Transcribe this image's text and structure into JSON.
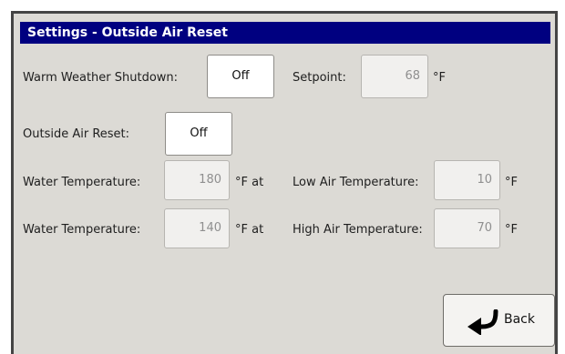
{
  "window": {
    "title": "Settings - Outside Air Reset"
  },
  "warm_weather": {
    "label": "Warm Weather Shutdown:",
    "toggle": "Off",
    "setpoint_label": "Setpoint:",
    "setpoint_value": "68",
    "unit": "°F"
  },
  "oar": {
    "label": "Outside Air Reset:",
    "toggle": "Off"
  },
  "rows": [
    {
      "water_label": "Water Temperature:",
      "water_value": "180",
      "unit_at": "°F  at",
      "air_label": "Low Air Temperature:",
      "air_value": "10",
      "unit": "°F"
    },
    {
      "water_label": "Water Temperature:",
      "water_value": "140",
      "unit_at": "°F  at",
      "air_label": "High Air Temperature:",
      "air_value": "70",
      "unit": "°F"
    }
  ],
  "back": {
    "label": "Back",
    "icon": "back-arrow-icon"
  }
}
